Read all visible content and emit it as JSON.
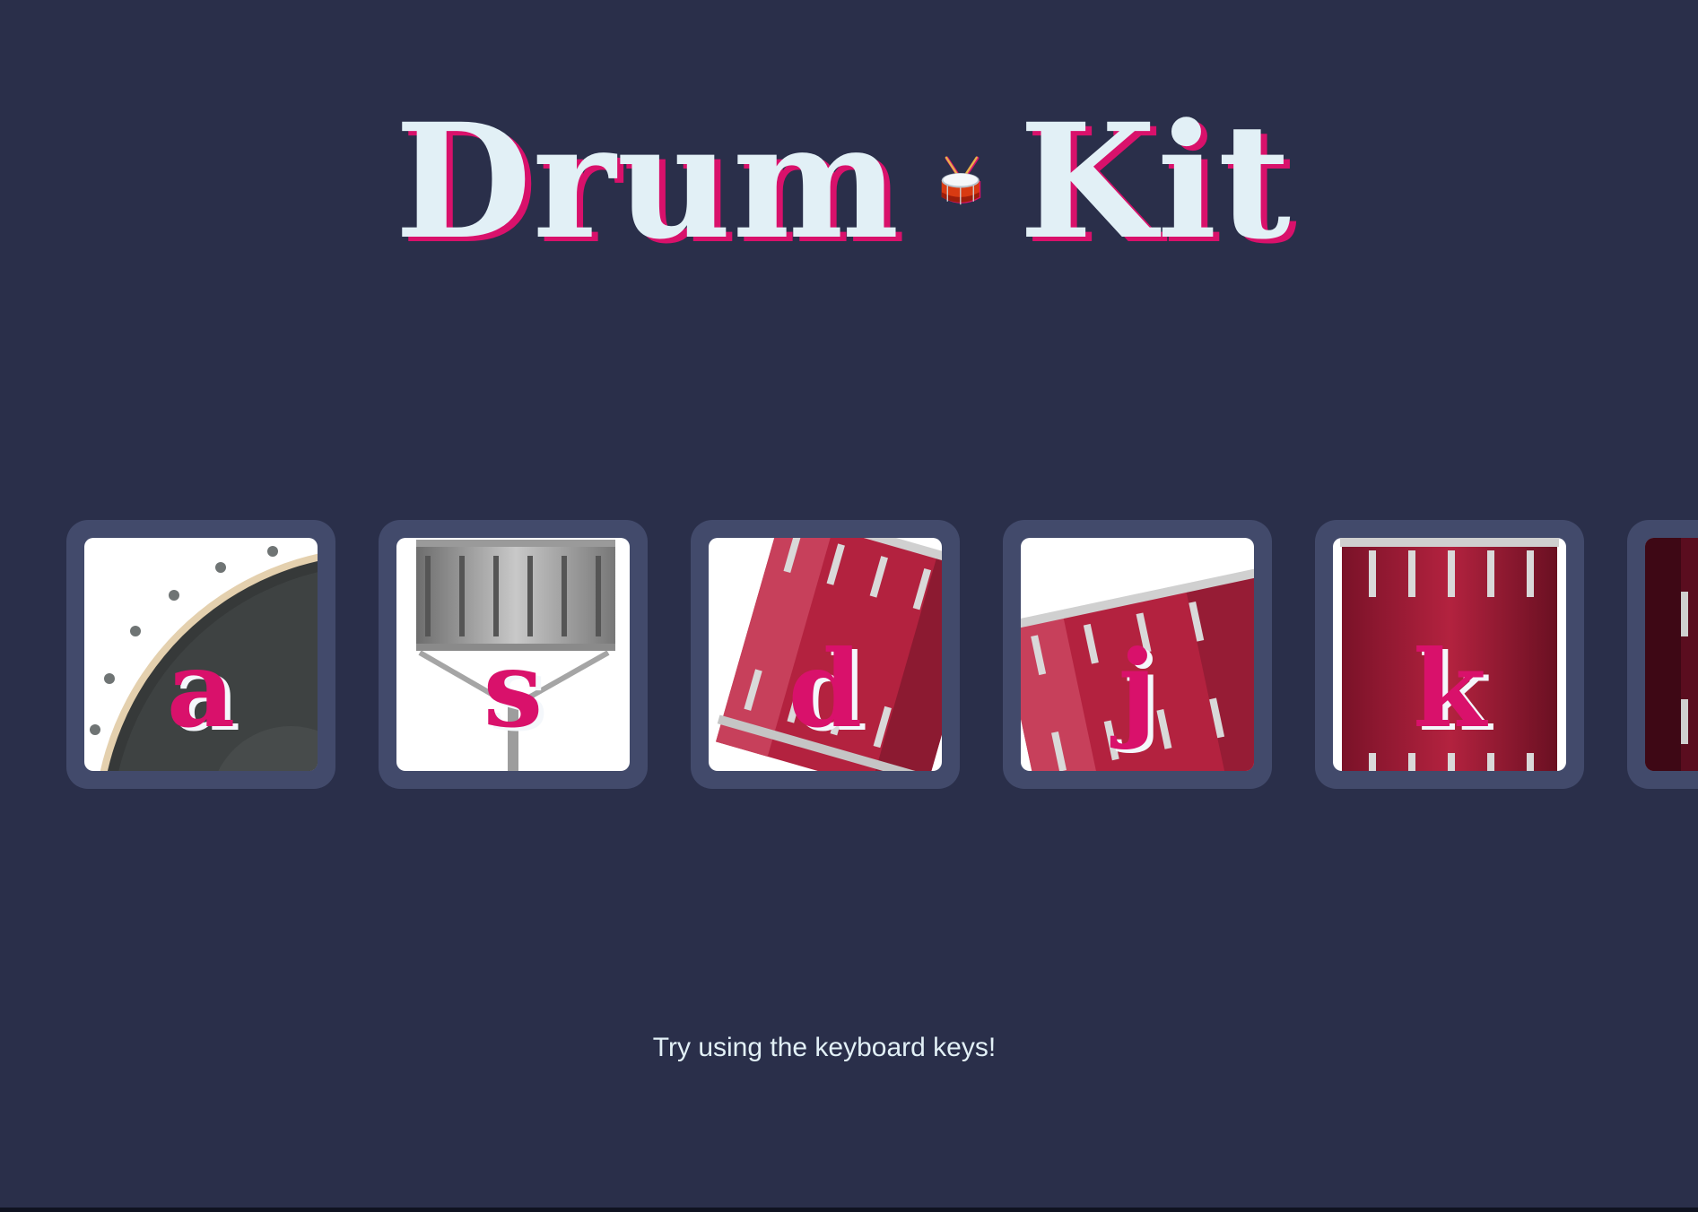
{
  "header": {
    "title_left": "Drum",
    "title_right": "Kit",
    "title_icon": "drum-emoji"
  },
  "pads": [
    {
      "key": "a",
      "instrument_icon": "bass-drum-icon"
    },
    {
      "key": "s",
      "instrument_icon": "snare-stand-icon"
    },
    {
      "key": "d",
      "instrument_icon": "tom-drum-icon"
    },
    {
      "key": "j",
      "instrument_icon": "tom-drum-icon"
    },
    {
      "key": "k",
      "instrument_icon": "floor-tom-icon"
    }
  ],
  "footer": {
    "hint": "Try using the keyboard keys!"
  },
  "colors": {
    "background": "#2a2f4a",
    "tile_border": "#424a6b",
    "accent": "#d9116b",
    "title_text": "#e2f0f6"
  }
}
